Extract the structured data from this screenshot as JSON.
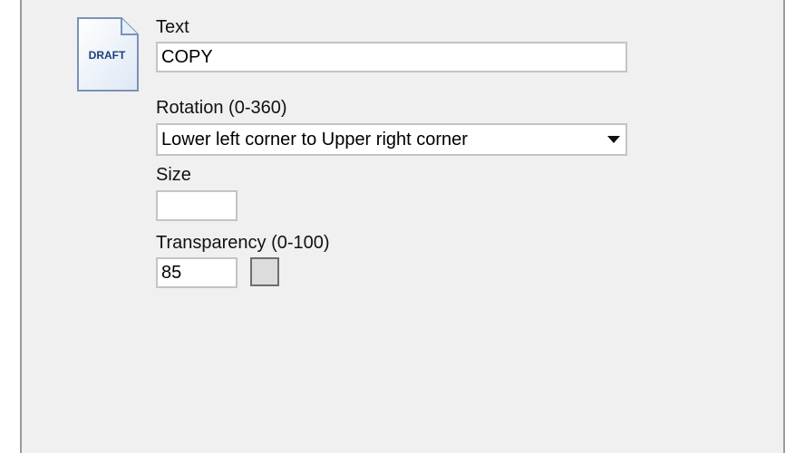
{
  "icon": {
    "name": "draft-document-icon",
    "caption": "DRAFT"
  },
  "text_field": {
    "label": "Text",
    "value": "COPY"
  },
  "rotation": {
    "label": "Rotation (0-360)",
    "selected": "Lower left corner to Upper right corner"
  },
  "size": {
    "label": "Size",
    "value": ""
  },
  "transparency": {
    "label": "Transparency (0-100)",
    "value": "85",
    "color": "#dcdcdc"
  }
}
